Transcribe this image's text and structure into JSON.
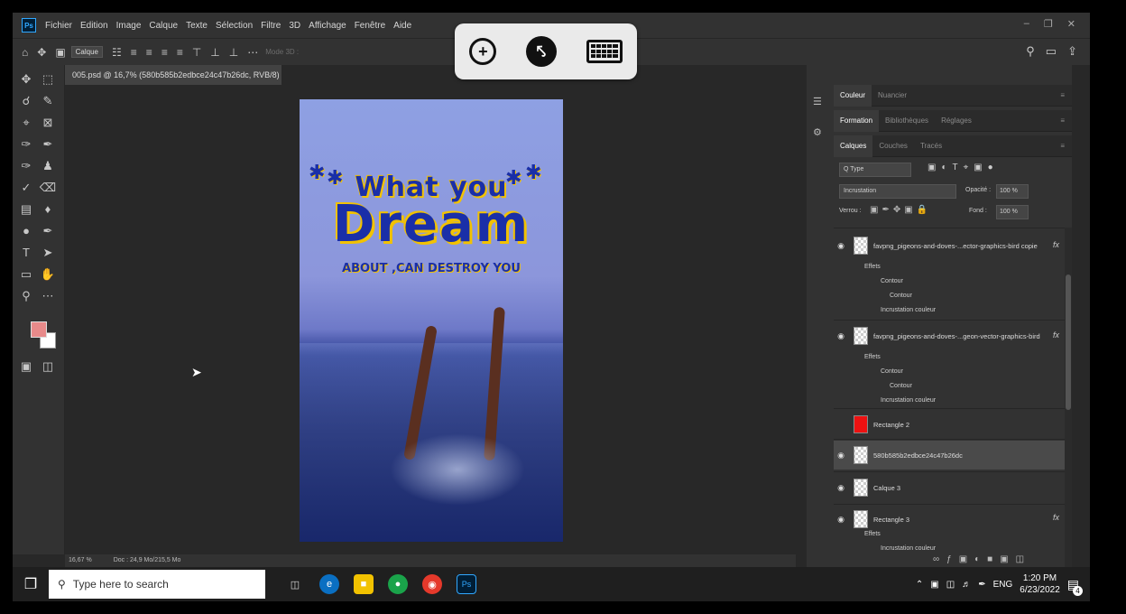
{
  "menubar": {
    "items": [
      "Fichier",
      "Edition",
      "Image",
      "Calque",
      "Texte",
      "Sélection",
      "Filtre",
      "3D",
      "Affichage",
      "Fenêtre",
      "Aide"
    ]
  },
  "options": {
    "layer_select": "Calque",
    "mode3d": "Mode 3D :"
  },
  "document": {
    "tab_title": "005.psd @ 16,7% (580b585b2edbce24c47b26dc, RVB/8) *",
    "zoom": "16,67 %",
    "doc_info": "Doc : 24,9 Mo/215,5 Mo"
  },
  "poster": {
    "line1": "What you",
    "line2": "Dream",
    "line3": "ABOUT ,CAN DESTROY YOU"
  },
  "panels": {
    "row1_tabs": [
      "Couleur",
      "Nuancier"
    ],
    "row2_tabs": [
      "Formation",
      "Bibliothèques",
      "Réglages"
    ],
    "row3_tabs": [
      "Calques",
      "Couches",
      "Tracés"
    ],
    "filter_label": "Q Type",
    "blend_mode": "Incrustation",
    "opacity_label": "Opacité :",
    "opacity_value": "100 %",
    "lock_label": "Verrou :",
    "fill_label": "Fond :",
    "fill_value": "100 %"
  },
  "layers": [
    {
      "name": "favpng_pigeons-and-doves-...ector-graphics-bird copie",
      "effects": "Effets",
      "sub": [
        "Contour",
        "Contour",
        "Incrustation couleur"
      ]
    },
    {
      "name": "favpng_pigeons-and-doves-...geon-vector-graphics-bird",
      "effects": "Effets",
      "sub": [
        "Contour",
        "Contour",
        "Incrustation couleur"
      ]
    },
    {
      "name": "Rectangle 2"
    },
    {
      "name": "580b585b2edbce24c47b26dc"
    },
    {
      "name": "Calque 3"
    },
    {
      "name": "Rectangle 3",
      "effects": "Effets",
      "sub": [
        "Incrustation couleur"
      ]
    }
  ],
  "taskbar": {
    "search_placeholder": "Type here to search",
    "lang": "ENG",
    "time": "1:20 PM",
    "date": "6/23/2022",
    "notifications": "4"
  }
}
